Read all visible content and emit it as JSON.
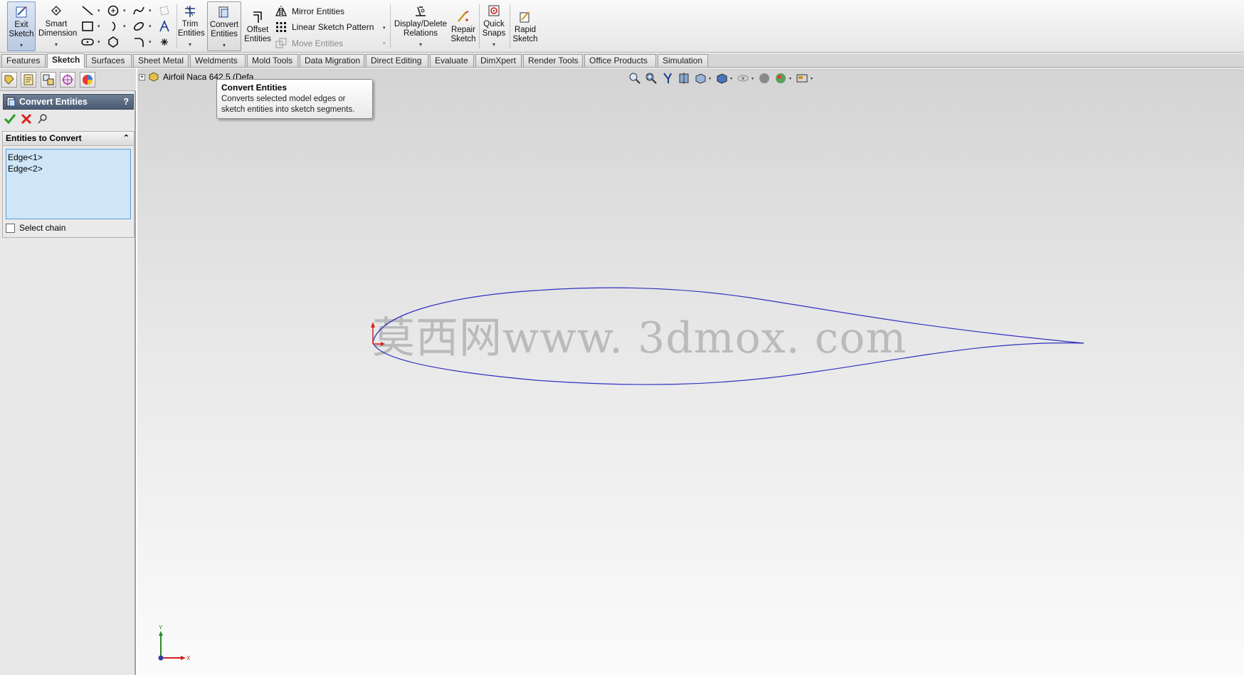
{
  "ribbon": {
    "exit_sketch": "Exit\nSketch",
    "exit_sketch_l1": "Exit",
    "exit_sketch_l2": "Sketch",
    "smart_dimension_l1": "Smart",
    "smart_dimension_l2": "Dimension",
    "trim_l1": "Trim",
    "trim_l2": "Entities",
    "convert_l1": "Convert",
    "convert_l2": "Entities",
    "offset_l1": "Offset",
    "offset_l2": "Entities",
    "mirror": "Mirror Entities",
    "linear_pattern": "Linear Sketch Pattern",
    "move": "Move Entities",
    "display_delete_l1": "Display/Delete",
    "display_delete_l2": "Relations",
    "repair_l1": "Repair",
    "repair_l2": "Sketch",
    "quick_snaps_l1": "Quick",
    "quick_snaps_l2": "Snaps",
    "rapid_l1": "Rapid",
    "rapid_l2": "Sketch"
  },
  "tabs": [
    "Features",
    "Sketch",
    "Surfaces",
    "Sheet Metal",
    "Weldments",
    "Mold Tools",
    "Data Migration",
    "Direct Editing",
    "Evaluate",
    "DimXpert",
    "Render Tools",
    "Office Products",
    "Simulation"
  ],
  "property_manager": {
    "title": "Convert Entities",
    "help": "?",
    "group_title": "Entities to Convert",
    "selections": [
      "Edge<1>",
      "Edge<2>"
    ],
    "select_chain": "Select chain"
  },
  "tree": {
    "root": "Airfoil Naca 642 5  (Defa"
  },
  "tooltip": {
    "title": "Convert Entities",
    "line1": "Converts selected model edges or",
    "line2": "sketch entities into sketch segments."
  },
  "watermark": "莫西网www. 3dmox. com",
  "triad": {
    "x": "X",
    "y": "Y"
  },
  "colors": {
    "sketch_line": "#3030c0",
    "origin": "#e02020",
    "pm_header": "#55657d",
    "selection_box": "#cfe6f8"
  }
}
